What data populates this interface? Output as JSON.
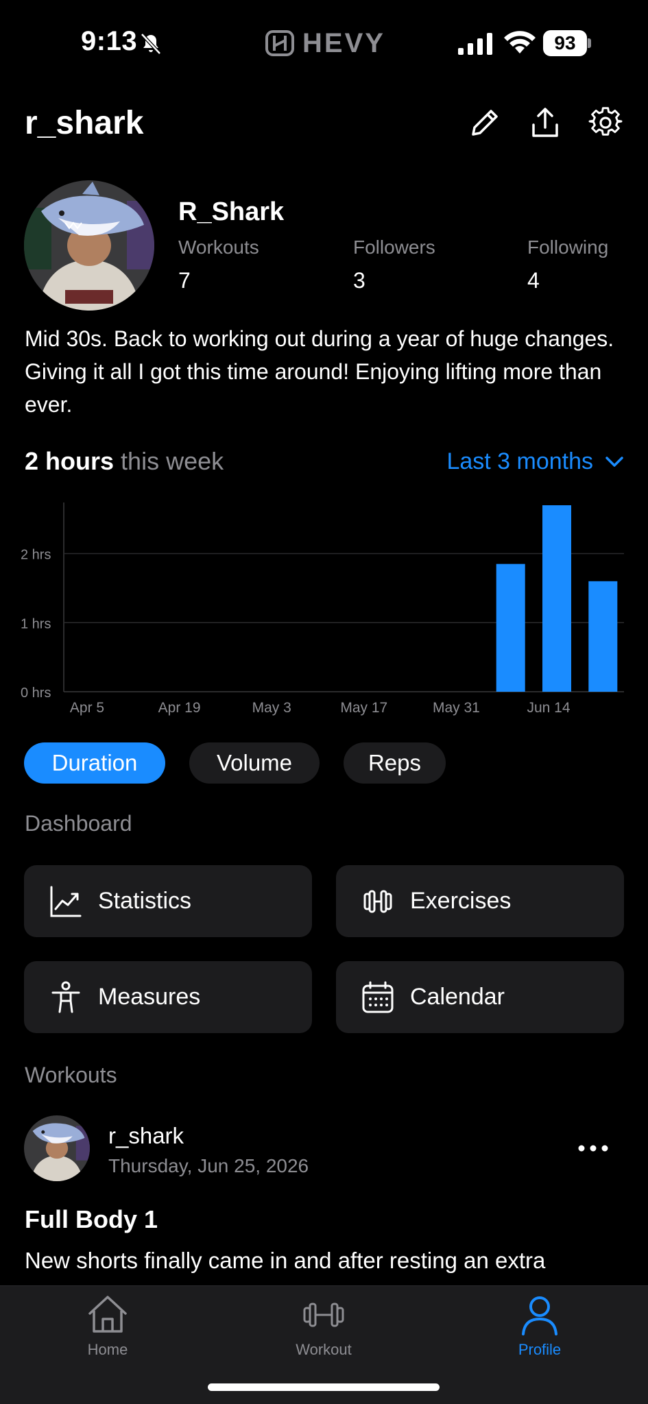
{
  "status_bar": {
    "time": "9:13",
    "battery": "93",
    "brand": "HEVY"
  },
  "header": {
    "username": "r_shark"
  },
  "profile": {
    "display_name": "R_Shark",
    "stats": [
      {
        "label": "Workouts",
        "value": "7"
      },
      {
        "label": "Followers",
        "value": "3"
      },
      {
        "label": "Following",
        "value": "4"
      }
    ],
    "bio": "Mid 30s. Back to working out during a year of huge changes. Giving it all I got this time around! Enjoying lifting more than ever."
  },
  "summary": {
    "value": "2 hours",
    "suffix": "this week",
    "range_label": "Last 3 months"
  },
  "chart_data": {
    "type": "bar",
    "categories": [
      "Apr 5",
      "Apr 19",
      "May 3",
      "May 17",
      "May 31",
      "Jun 14"
    ],
    "x_ticks": [
      "Apr 5",
      "Apr 19",
      "May 3",
      "May 17",
      "May 31",
      "Jun 14"
    ],
    "y_ticks": [
      "0 hrs",
      "1 hrs",
      "2 hrs"
    ],
    "bars": [
      {
        "week": "Jun 7",
        "value": 1.85
      },
      {
        "week": "Jun 14",
        "value": 2.7
      },
      {
        "week": "Jun 21",
        "value": 1.6
      }
    ],
    "ylabel": "",
    "xlabel": "",
    "ylim": [
      0,
      2.7
    ],
    "grid": true,
    "bar_color": "#1a8cff"
  },
  "metric_tabs": [
    {
      "label": "Duration",
      "active": true
    },
    {
      "label": "Volume",
      "active": false
    },
    {
      "label": "Reps",
      "active": false
    }
  ],
  "dashboard": {
    "title": "Dashboard",
    "items": [
      {
        "label": "Statistics",
        "icon": "chart-trend-icon"
      },
      {
        "label": "Exercises",
        "icon": "dumbbell-icon"
      },
      {
        "label": "Measures",
        "icon": "person-icon"
      },
      {
        "label": "Calendar",
        "icon": "calendar-icon"
      }
    ]
  },
  "workouts": {
    "title": "Workouts",
    "post": {
      "user": "r_shark",
      "date": "Thursday, Jun 25, 2026",
      "title": "Full Body 1",
      "description": "New shorts finally came in and after resting an extra"
    }
  },
  "tab_bar": {
    "items": [
      {
        "label": "Home",
        "icon": "home-icon"
      },
      {
        "label": "Workout",
        "icon": "dumbbell-icon"
      },
      {
        "label": "Profile",
        "icon": "profile-icon",
        "active": true
      }
    ]
  },
  "colors": {
    "accent": "#1a8cff",
    "card": "#1c1c1e",
    "muted": "#8e8e93"
  }
}
